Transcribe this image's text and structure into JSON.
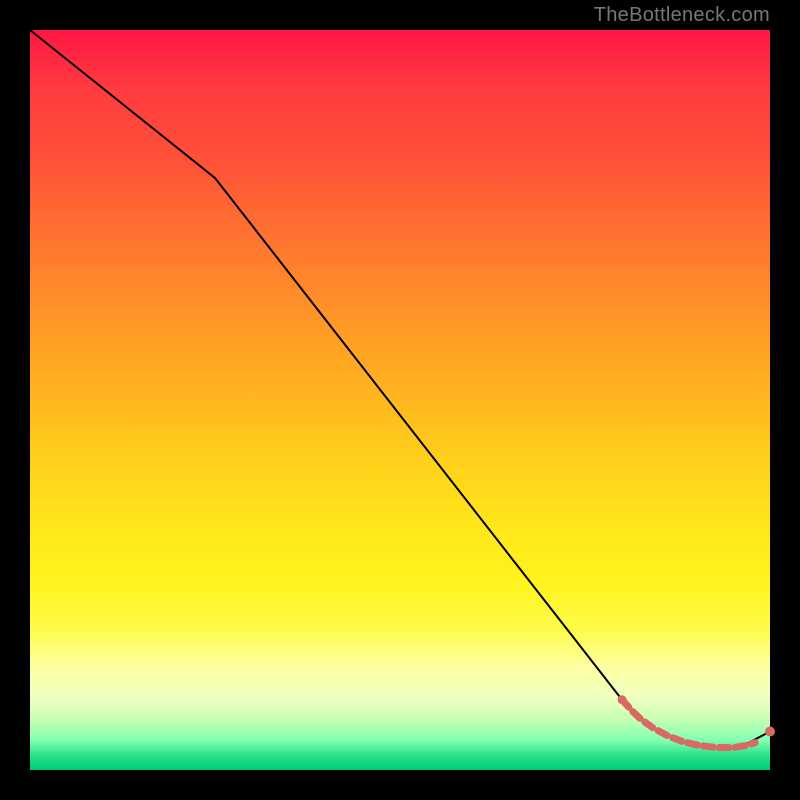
{
  "watermark": "TheBottleneck.com",
  "colors": {
    "line": "#000000",
    "dotted": "#d86a63",
    "marker": "#d86a63"
  },
  "chart_data": {
    "type": "line",
    "title": "",
    "xlabel": "",
    "ylabel": "",
    "xlim": [
      0,
      100
    ],
    "ylim": [
      0,
      100
    ],
    "grid": false,
    "legend": false,
    "series": [
      {
        "name": "main-curve",
        "style": "solid",
        "color": "#000000",
        "x": [
          0,
          25,
          80,
          84,
          86,
          88,
          90,
          92,
          94,
          96,
          100
        ],
        "y": [
          100,
          80,
          9.5,
          5.8,
          4.7,
          3.9,
          3.4,
          3.1,
          3.0,
          3.1,
          5.2
        ]
      },
      {
        "name": "lower-dotted",
        "style": "dotted",
        "color": "#d86a63",
        "x": [
          80,
          82,
          84,
          86,
          88,
          90,
          92,
          94,
          96,
          98
        ],
        "y": [
          9.5,
          7.3,
          5.8,
          4.7,
          3.9,
          3.4,
          3.1,
          3.0,
          3.1,
          3.7
        ]
      }
    ],
    "markers": [
      {
        "x": 100,
        "y": 5.2,
        "color": "#d86a63"
      }
    ]
  }
}
